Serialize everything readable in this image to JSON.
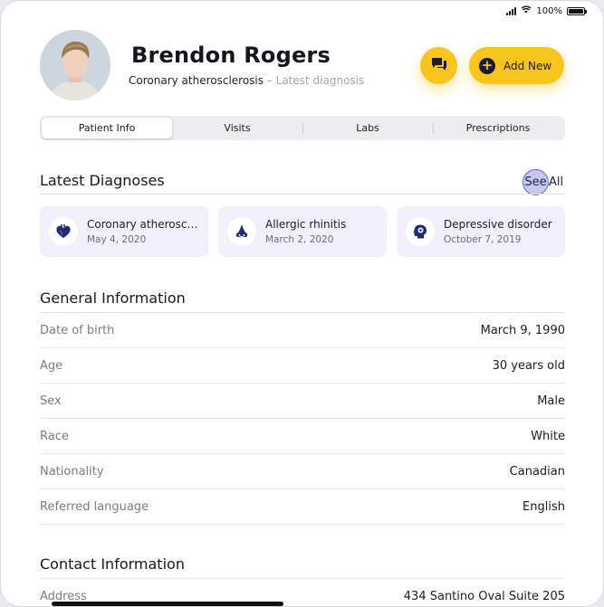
{
  "status_bar": {
    "battery": "100%"
  },
  "patient": {
    "name": "Brendon Rogers",
    "diagnosis": "Coronary atherosclerosis",
    "diagnosis_note": " – Latest diagnosis"
  },
  "actions": {
    "add_new_label": "Add New"
  },
  "tabs": [
    {
      "label": "Patient Info"
    },
    {
      "label": "Visits"
    },
    {
      "label": "Labs"
    },
    {
      "label": "Prescriptions"
    }
  ],
  "latest_diagnoses": {
    "title": "Latest Diagnoses",
    "see_label": "See",
    "all_label": "All",
    "items": [
      {
        "name": "Coronary atherosclerosis",
        "date": "May 4, 2020",
        "icon": "heart-icon"
      },
      {
        "name": "Allergic rhinitis",
        "date": "March 2, 2020",
        "icon": "nose-icon"
      },
      {
        "name": "Depressive disorder",
        "date": "October 7, 2019",
        "icon": "brain-head-icon"
      }
    ]
  },
  "general_information": {
    "title": "General Information",
    "rows": [
      {
        "label": "Date of birth",
        "value": "March 9, 1990"
      },
      {
        "label": "Age",
        "value": "30 years old"
      },
      {
        "label": "Sex",
        "value": "Male"
      },
      {
        "label": "Race",
        "value": "White"
      },
      {
        "label": "Nationality",
        "value": "Canadian"
      },
      {
        "label": "Referred language",
        "value": "English"
      }
    ]
  },
  "contact_information": {
    "title": "Contact Information",
    "rows": [
      {
        "label": "Address",
        "value": "434 Santino Oval Suite 205"
      }
    ]
  },
  "colors": {
    "accent": "#f9c41e",
    "card_bg": "#f1f0fb",
    "icon_navy": "#1e2a78"
  }
}
